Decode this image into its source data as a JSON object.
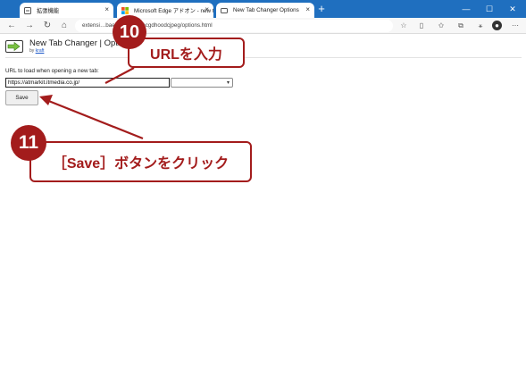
{
  "browser": {
    "tabs": [
      {
        "label": "拡張機能"
      },
      {
        "label": "Microsoft Edge アドオン - new tab"
      },
      {
        "label": "New Tab Changer Options"
      }
    ],
    "address": "extensi…baeajdpekcdhmcgdhoodcjpeg/options.html"
  },
  "page": {
    "ext_title": "New Tab Changer | Options",
    "by_label": "by",
    "by_link": "kraft",
    "url_label": "URL to load when opening a new tab:",
    "url_value": "https://atmarkit.itmedia.co.jp/",
    "save_label": "Save"
  },
  "annotations": {
    "step10_number": "10",
    "step10_text": "URLを入力",
    "step11_number": "11",
    "step11_text": "［Save］ボタンをクリック"
  },
  "colors": {
    "accent": "#a31c1c",
    "tabbar": "#1f6fbf"
  }
}
